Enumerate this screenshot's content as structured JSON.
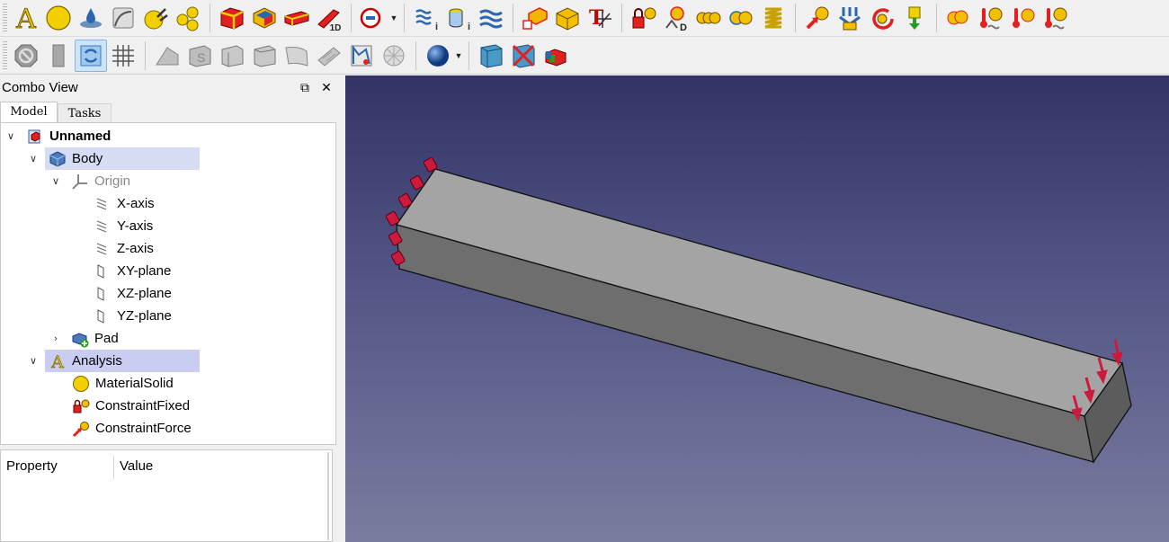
{
  "toolbar1": {
    "buttons": [
      "analysis-icon",
      "material-solid-icon",
      "material-fluid-icon",
      "nonlinear-material-icon",
      "material-editor-icon",
      "material-reinforced-icon",
      "solid-section-icon",
      "beam-section-icon",
      "beam-rotation-icon",
      "shell-thickness-icon",
      "boolean-fragments-icon",
      "flow-velocity-icon",
      "initial-flow-icon",
      "fluid-boundary-icon",
      "contact-icon",
      "displacement-icon",
      "tie-icon",
      "fixed-constraint-icon",
      "planar-constraint-icon",
      "transform-icon",
      "gear-spring-icon",
      "force-icon",
      "pressure-icon",
      "centrif-icon",
      "body-heat-icon",
      "self-weight-icon",
      "heat-flux-icon",
      "initial-temp-icon",
      "temperature-icon"
    ]
  },
  "toolbar2": {
    "buttons": [
      "stop-icon",
      "box-icon",
      "refresh-icon",
      "grid-icon",
      "bspline-icon",
      "sweep-icon",
      "loft-icon",
      "prism-icon",
      "ruled-icon",
      "surface-icon",
      "edge-icon",
      "mesh-icon",
      "sphere-icon",
      "face-icon",
      "no-face-icon",
      "elements-icon"
    ]
  },
  "combo": {
    "title": "Combo View",
    "tabs": {
      "model": "Model",
      "tasks": "Tasks"
    }
  },
  "tree": {
    "unnamed": "Unnamed",
    "body": "Body",
    "origin": "Origin",
    "x_axis": "X-axis",
    "y_axis": "Y-axis",
    "z_axis": "Z-axis",
    "xy_plane": "XY-plane",
    "xz_plane": "XZ-plane",
    "yz_plane": "YZ-plane",
    "pad": "Pad",
    "analysis": "Analysis",
    "material": "MaterialSolid",
    "fixed": "ConstraintFixed",
    "force": "ConstraintForce"
  },
  "properties": {
    "property": "Property",
    "value": "Value"
  },
  "colors": {
    "selection": "#d7dcf5",
    "constraint": "#cc1a3c",
    "beam_top": "#a4a4a4",
    "beam_front": "#6e6e6e"
  }
}
